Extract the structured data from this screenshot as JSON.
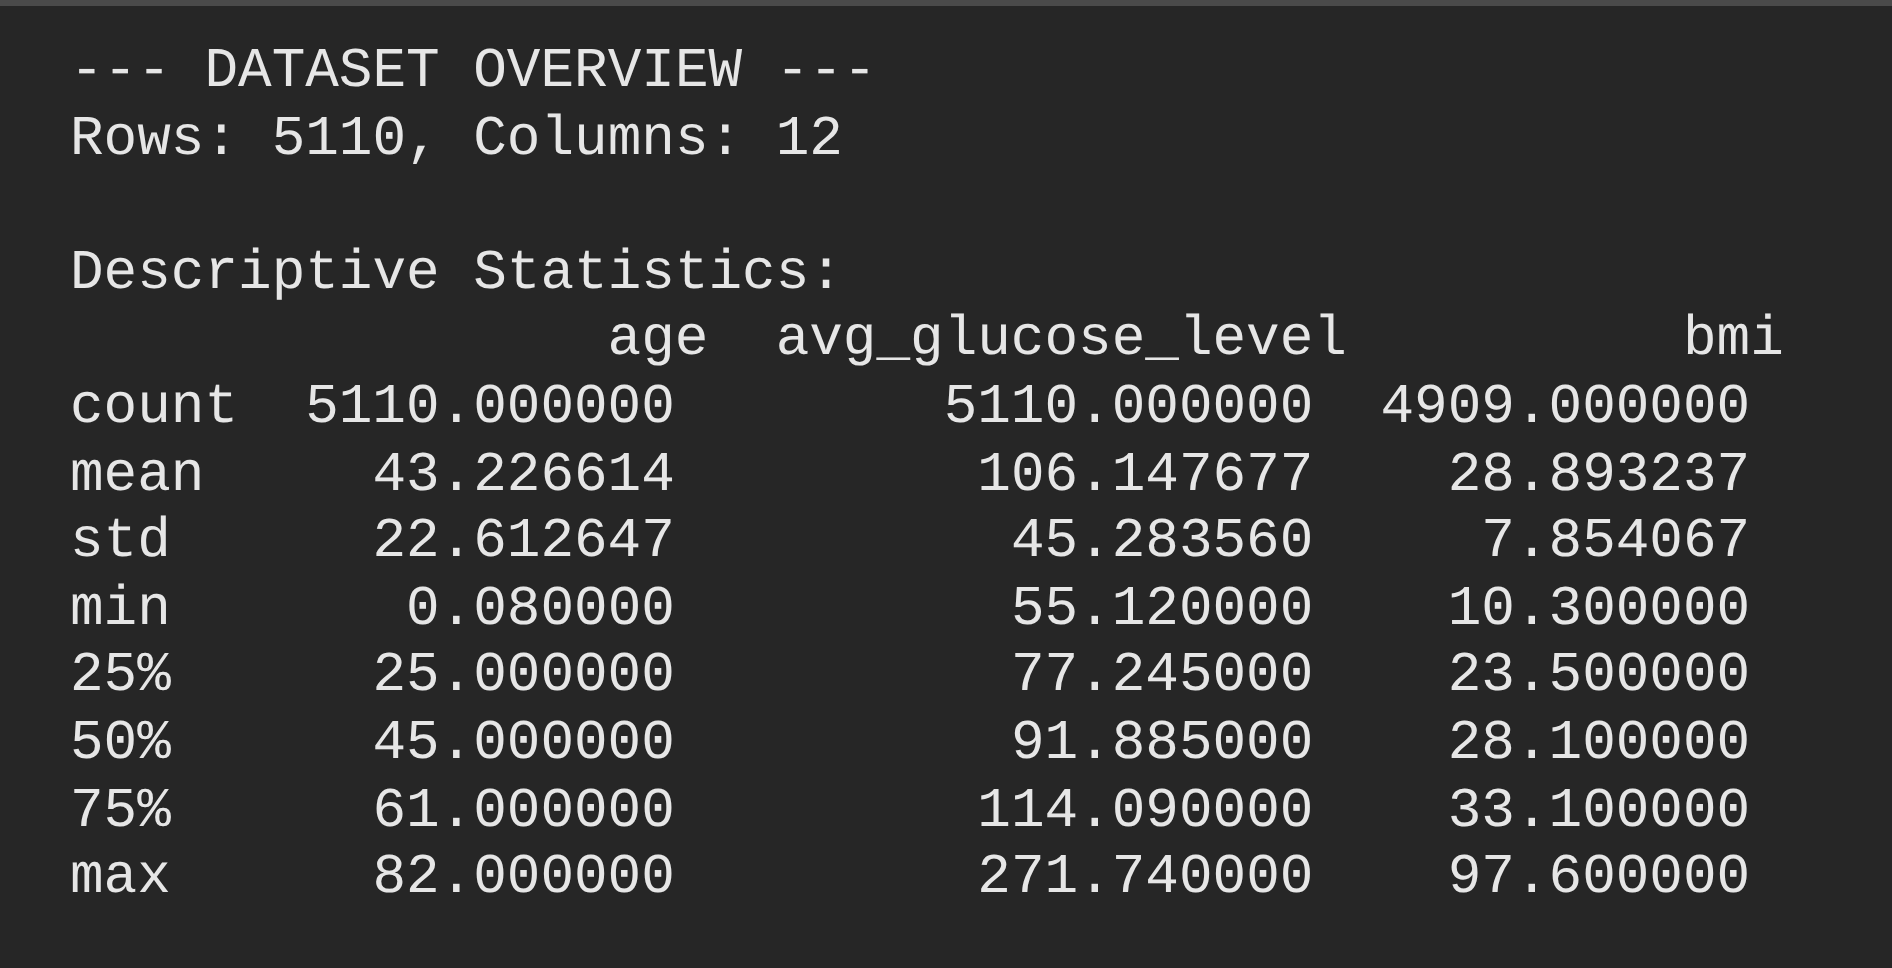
{
  "heading": "--- DATASET OVERVIEW ---",
  "summary": "Rows: 5110, Columns: 12",
  "stats_title": "Descriptive Statistics:",
  "table": {
    "columns": [
      "age",
      "avg_glucose_level",
      "bmi"
    ],
    "rows": [
      {
        "label": "count",
        "values": [
          "5110.000000",
          "5110.000000",
          "4909.000000"
        ]
      },
      {
        "label": "mean",
        "values": [
          "43.226614",
          "106.147677",
          "28.893237"
        ]
      },
      {
        "label": "std",
        "values": [
          "22.612647",
          "45.283560",
          "7.854067"
        ]
      },
      {
        "label": "min",
        "values": [
          "0.080000",
          "55.120000",
          "10.300000"
        ]
      },
      {
        "label": "25%",
        "values": [
          "25.000000",
          "77.245000",
          "23.500000"
        ]
      },
      {
        "label": "50%",
        "values": [
          "45.000000",
          "91.885000",
          "28.100000"
        ]
      },
      {
        "label": "75%",
        "values": [
          "61.000000",
          "114.090000",
          "33.100000"
        ]
      },
      {
        "label": "max",
        "values": [
          "82.000000",
          "271.740000",
          "97.600000"
        ]
      }
    ]
  }
}
